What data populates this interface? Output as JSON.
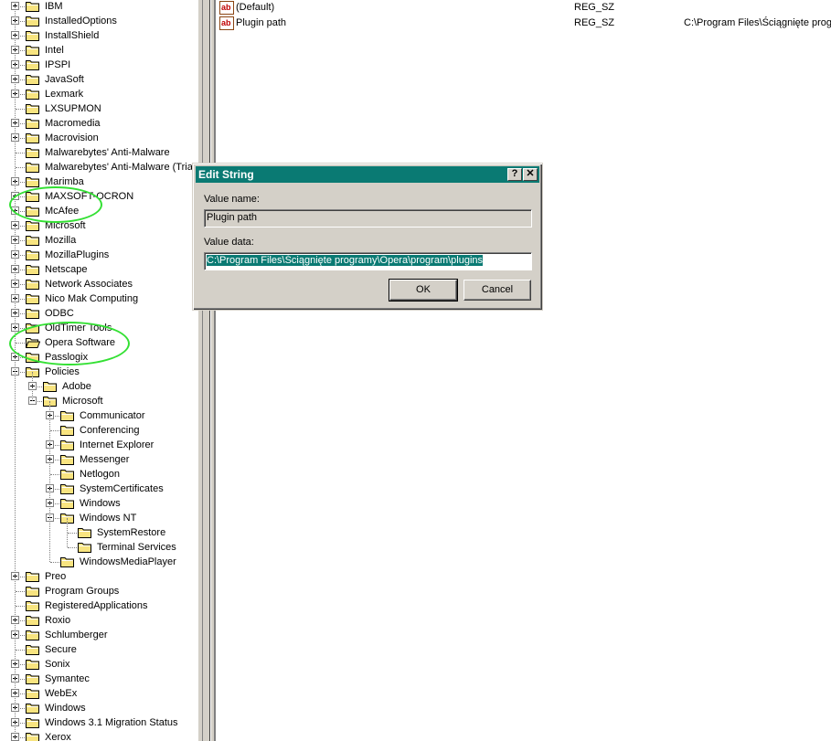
{
  "tree": {
    "items": [
      {
        "label": "IBM",
        "level": 0,
        "expander": "plus"
      },
      {
        "label": "InstalledOptions",
        "level": 0,
        "expander": "plus"
      },
      {
        "label": "InstallShield",
        "level": 0,
        "expander": "plus"
      },
      {
        "label": "Intel",
        "level": 0,
        "expander": "plus"
      },
      {
        "label": "IPSPI",
        "level": 0,
        "expander": "plus"
      },
      {
        "label": "JavaSoft",
        "level": 0,
        "expander": "plus"
      },
      {
        "label": "Lexmark",
        "level": 0,
        "expander": "plus"
      },
      {
        "label": "LXSUPMON",
        "level": 0,
        "expander": "none"
      },
      {
        "label": "Macromedia",
        "level": 0,
        "expander": "plus"
      },
      {
        "label": "Macrovision",
        "level": 0,
        "expander": "plus"
      },
      {
        "label": "Malwarebytes' Anti-Malware",
        "level": 0,
        "expander": "none"
      },
      {
        "label": "Malwarebytes' Anti-Malware (Trial)",
        "level": 0,
        "expander": "none"
      },
      {
        "label": "Marimba",
        "level": 0,
        "expander": "plus"
      },
      {
        "label": "MAXSOFT-OCRON",
        "level": 0,
        "expander": "plus"
      },
      {
        "label": "McAfee",
        "level": 0,
        "expander": "plus"
      },
      {
        "label": "Microsoft",
        "level": 0,
        "expander": "plus"
      },
      {
        "label": "Mozilla",
        "level": 0,
        "expander": "plus"
      },
      {
        "label": "MozillaPlugins",
        "level": 0,
        "expander": "plus"
      },
      {
        "label": "Netscape",
        "level": 0,
        "expander": "plus"
      },
      {
        "label": "Network Associates",
        "level": 0,
        "expander": "plus"
      },
      {
        "label": "Nico Mak Computing",
        "level": 0,
        "expander": "plus"
      },
      {
        "label": "ODBC",
        "level": 0,
        "expander": "plus"
      },
      {
        "label": "OldTimer Tools",
        "level": 0,
        "expander": "plus"
      },
      {
        "label": "Opera Software",
        "level": 0,
        "expander": "none",
        "open": true
      },
      {
        "label": "Passlogix",
        "level": 0,
        "expander": "plus"
      },
      {
        "label": "Policies",
        "level": 0,
        "expander": "minus"
      },
      {
        "label": "Adobe",
        "level": 1,
        "expander": "plus"
      },
      {
        "label": "Microsoft",
        "level": 1,
        "expander": "minus"
      },
      {
        "label": "Communicator",
        "level": 2,
        "expander": "plus"
      },
      {
        "label": "Conferencing",
        "level": 2,
        "expander": "none"
      },
      {
        "label": "Internet Explorer",
        "level": 2,
        "expander": "plus"
      },
      {
        "label": "Messenger",
        "level": 2,
        "expander": "plus"
      },
      {
        "label": "Netlogon",
        "level": 2,
        "expander": "none"
      },
      {
        "label": "SystemCertificates",
        "level": 2,
        "expander": "plus"
      },
      {
        "label": "Windows",
        "level": 2,
        "expander": "plus"
      },
      {
        "label": "Windows NT",
        "level": 2,
        "expander": "minus"
      },
      {
        "label": "SystemRestore",
        "level": 3,
        "expander": "none"
      },
      {
        "label": "Terminal Services",
        "level": 3,
        "expander": "none"
      },
      {
        "label": "WindowsMediaPlayer",
        "level": 2,
        "expander": "none"
      },
      {
        "label": "Preo",
        "level": 0,
        "expander": "plus"
      },
      {
        "label": "Program Groups",
        "level": 0,
        "expander": "none"
      },
      {
        "label": "RegisteredApplications",
        "level": 0,
        "expander": "none"
      },
      {
        "label": "Roxio",
        "level": 0,
        "expander": "plus"
      },
      {
        "label": "Schlumberger",
        "level": 0,
        "expander": "plus"
      },
      {
        "label": "Secure",
        "level": 0,
        "expander": "none"
      },
      {
        "label": "Sonix",
        "level": 0,
        "expander": "plus"
      },
      {
        "label": "Symantec",
        "level": 0,
        "expander": "plus"
      },
      {
        "label": "WebEx",
        "level": 0,
        "expander": "plus"
      },
      {
        "label": "Windows",
        "level": 0,
        "expander": "plus"
      },
      {
        "label": "Windows 3.1 Migration Status",
        "level": 0,
        "expander": "plus"
      },
      {
        "label": "Xerox",
        "level": 0,
        "expander": "plus"
      }
    ]
  },
  "values": {
    "rows": [
      {
        "name": "(Default)",
        "type": "REG_SZ",
        "data": ""
      },
      {
        "name": "Plugin path",
        "type": "REG_SZ",
        "data": "C:\\Program Files\\Ściągnięte progra"
      }
    ]
  },
  "dialog": {
    "title": "Edit String",
    "help_label": "?",
    "close_label": "✕",
    "value_name_label": "Value name:",
    "value_name": "Plugin path",
    "value_data_label": "Value data:",
    "value_data": "C:\\Program Files\\Ściągnięte programy\\Opera\\program\\plugins",
    "ok_label": "OK",
    "cancel_label": "Cancel"
  },
  "colors": {
    "titlebar": "#0a7a73",
    "annotation": "#33e033",
    "folder": "#f8e480"
  }
}
